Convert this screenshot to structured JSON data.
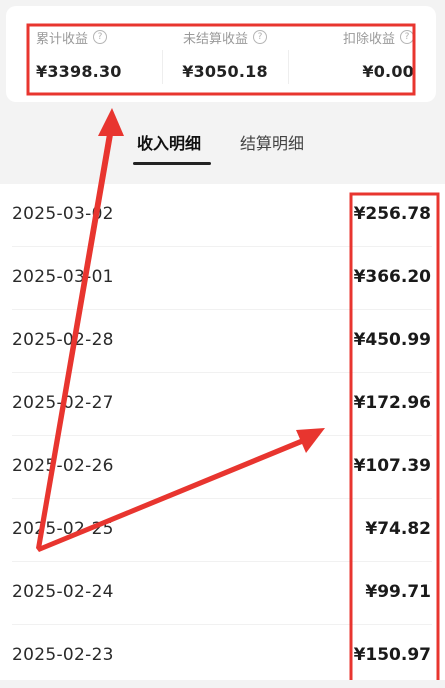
{
  "summary": {
    "items": [
      {
        "label": "累计收益",
        "help_icon": "question-circle-icon",
        "value": "¥3398.30"
      },
      {
        "label": "未结算收益",
        "help_icon": "question-circle-icon",
        "value": "¥3050.18"
      },
      {
        "label": "扣除收益",
        "help_icon": "question-circle-icon",
        "value": "¥0.00"
      }
    ]
  },
  "tabs": [
    {
      "label": "收入明细",
      "active": true
    },
    {
      "label": "结算明细",
      "active": false
    }
  ],
  "entries": [
    {
      "date": "2025-03-02",
      "amount": "¥256.78"
    },
    {
      "date": "2025-03-01",
      "amount": "¥366.20"
    },
    {
      "date": "2025-02-28",
      "amount": "¥450.99"
    },
    {
      "date": "2025-02-27",
      "amount": "¥172.96"
    },
    {
      "date": "2025-02-26",
      "amount": "¥107.39"
    },
    {
      "date": "2025-02-25",
      "amount": "¥74.82"
    },
    {
      "date": "2025-02-24",
      "amount": "¥99.71"
    },
    {
      "date": "2025-02-23",
      "amount": "¥150.97"
    }
  ],
  "colors": {
    "annotation": "#e8352f",
    "page_background": "#f3f3f3"
  }
}
